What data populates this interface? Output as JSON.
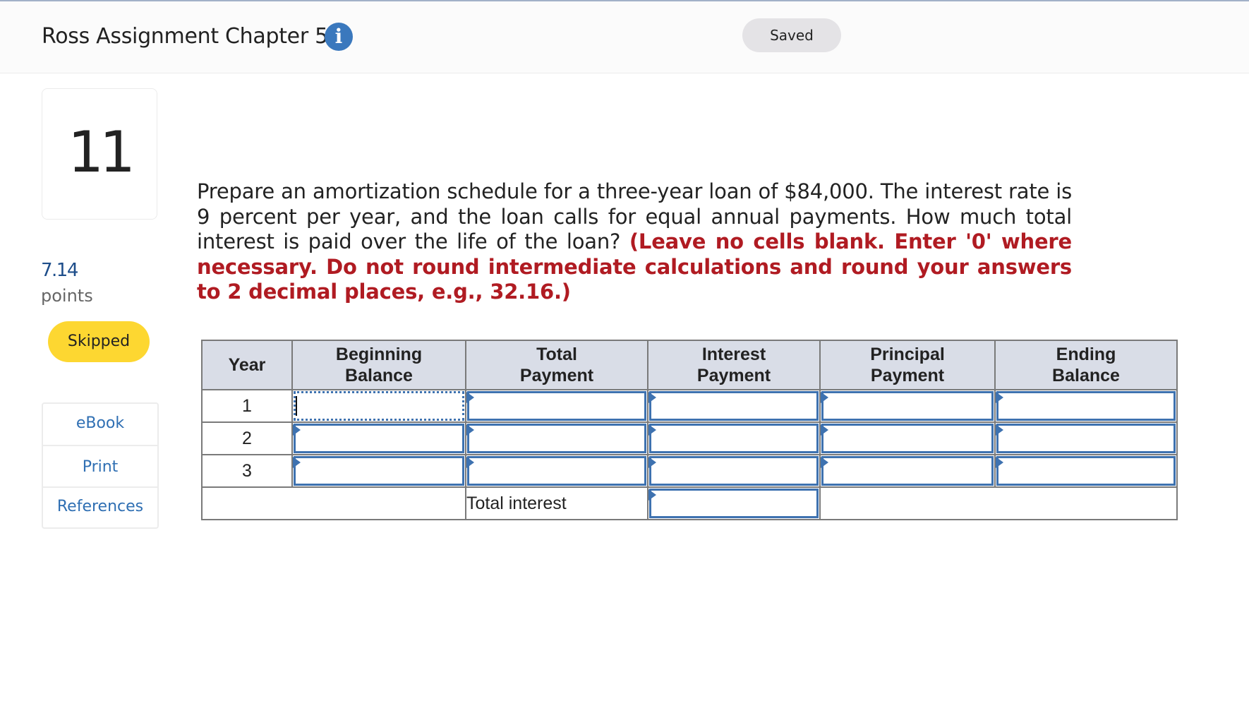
{
  "header": {
    "title": "Ross Assignment Chapter 5",
    "info_icon": "i",
    "saved_label": "Saved"
  },
  "question": {
    "number": "11",
    "points_value": "7.14",
    "points_label": "points",
    "status": "Skipped",
    "text_plain": "Prepare an amortization schedule for a three-year loan of $84,000. The interest rate is 9 percent per year, and the loan calls for equal annual payments. How much total interest is paid over the life of the loan? ",
    "text_instructions": "(Leave no cells blank. Enter '0' where necessary. Do not round intermediate calculations and round your answers to 2 decimal places, e.g., 32.16.)"
  },
  "links": [
    {
      "label": "eBook"
    },
    {
      "label": "Print"
    },
    {
      "label": "References"
    }
  ],
  "table": {
    "headers": {
      "year": "Year",
      "beginning_balance_1": "Beginning",
      "beginning_balance_2": "Balance",
      "total_payment_1": "Total",
      "total_payment_2": "Payment",
      "interest_payment_1": "Interest",
      "interest_payment_2": "Payment",
      "principal_payment_1": "Principal",
      "principal_payment_2": "Payment",
      "ending_balance_1": "Ending",
      "ending_balance_2": "Balance"
    },
    "rows": [
      {
        "year": "1",
        "beginning_balance": "",
        "total_payment": "",
        "interest_payment": "",
        "principal_payment": "",
        "ending_balance": ""
      },
      {
        "year": "2",
        "beginning_balance": "",
        "total_payment": "",
        "interest_payment": "",
        "principal_payment": "",
        "ending_balance": ""
      },
      {
        "year": "3",
        "beginning_balance": "",
        "total_payment": "",
        "interest_payment": "",
        "principal_payment": "",
        "ending_balance": ""
      }
    ],
    "total_interest_label": "Total interest",
    "total_interest_value": ""
  },
  "colors": {
    "accent_blue": "#3e72b0",
    "instruction_red": "#b01b22",
    "skipped_yellow": "#fdd731",
    "header_bg": "#d9dde7"
  }
}
